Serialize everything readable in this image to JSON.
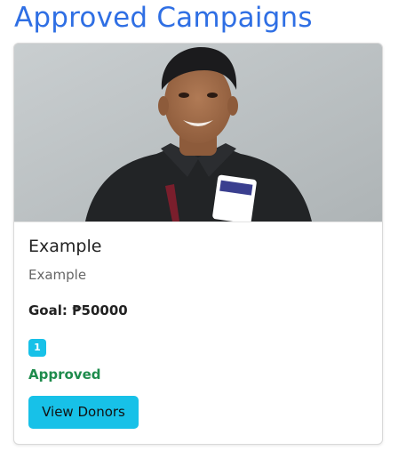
{
  "page": {
    "title": "Approved Campaigns"
  },
  "campaign": {
    "title": "Example",
    "description": "Example",
    "goal": "Goal: ₱50000",
    "badge": "1",
    "status": "Approved",
    "view_donors_label": "View Donors",
    "image_content": "campaign-photo"
  },
  "colors": {
    "heading": "#2f6fe4",
    "accent": "#17c1e8",
    "status_approved": "#1f8c4d"
  }
}
